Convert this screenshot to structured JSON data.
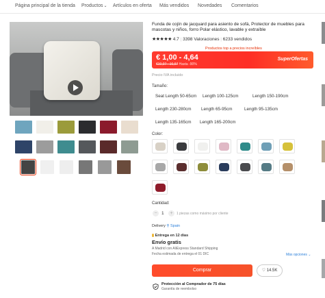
{
  "nav": {
    "items": [
      {
        "label": "Página principal de la tienda",
        "icon": null
      },
      {
        "label": "Productos",
        "icon": "chevron-down-icon"
      },
      {
        "label": "Artículos en oferta",
        "icon": null
      },
      {
        "label": "Más vendidos",
        "icon": null
      },
      {
        "label": "Novedades",
        "icon": null
      },
      {
        "label": "Comentarios",
        "icon": null
      }
    ]
  },
  "gallery": {
    "main_icon": "play-icon",
    "thumb_colors": [
      "#6fa5be",
      "#f1efe9",
      "#9b9b3b",
      "#2b2c2f",
      "#8b1b2c",
      "#e9ddcf",
      "#2e4468",
      "#9c9c9c",
      "#3f8c8f",
      "#55585c",
      "#5a2a2a",
      "#8e9b92"
    ],
    "small_thumbs": [
      "#444",
      "#f0f0f0",
      "#eee",
      "#777",
      "#999",
      "#6a4b3c"
    ]
  },
  "product": {
    "title": "Funda de cojín de jacquard para asiento de sofá, Protector de muebles para mascotas y niños, forro Polar elástico, lavable y extraíble",
    "stars": "★★★★★",
    "rating_value": "4.7",
    "reviews": "3398 Valoraciones",
    "sold": "6233 vendidos",
    "promo_top": "Productos top a precios increíbles",
    "price": "€ 1,00 - 4,64",
    "old_price": "€10,97 - 16,97",
    "discount": "Hasta -90%",
    "super_label": "SuperOfertas",
    "tax_note": "Precio IVA incluido",
    "accent": "#fe2e26"
  },
  "size": {
    "label": "Tamaño:",
    "options": [
      "Seat Length 50-65cm",
      "Length 100-125cm",
      "Length 150-190cm",
      "Length 230-280cm",
      "Length 65-95cm",
      "Length 95-135cm",
      "Length 135-165cm",
      "Length 165-200cm"
    ]
  },
  "color": {
    "label": "Color:",
    "swatches": [
      "#d8d1c6",
      "#3a3b3e",
      "#f0f0ee",
      "#e0b9c6",
      "#2f8b8a",
      "#6f9fb6",
      "#d6c13a",
      "#a8a8a8",
      "#5b2e2e",
      "#8d8c3a",
      "#2a3c5c",
      "#4a4b4e",
      "#557b85",
      "#b5906a",
      "#8f1c2b"
    ]
  },
  "quantity": {
    "label": "Cantidad:",
    "value": "1",
    "note": "1 piezas como máximo por cliente",
    "minus": "−",
    "plus": "+"
  },
  "delivery": {
    "label": "Delivery",
    "location_icon": "pin-icon",
    "location": "Spain",
    "badge": "Entrega en 12 días",
    "title": "Envío gratis",
    "line1": "A Madrid con AliExpress Standard Shipping",
    "line2": "Fecha estimada de entrega el 01 DIC",
    "more": "Más opciones"
  },
  "actions": {
    "buy": "Comprar",
    "wish_count": "14.5K",
    "heart_icon": "heart-icon"
  },
  "protection": {
    "icon": "shield-check-icon",
    "title": "Protección al Comprador de 75 días",
    "sub": "Garantía de reembolso"
  }
}
